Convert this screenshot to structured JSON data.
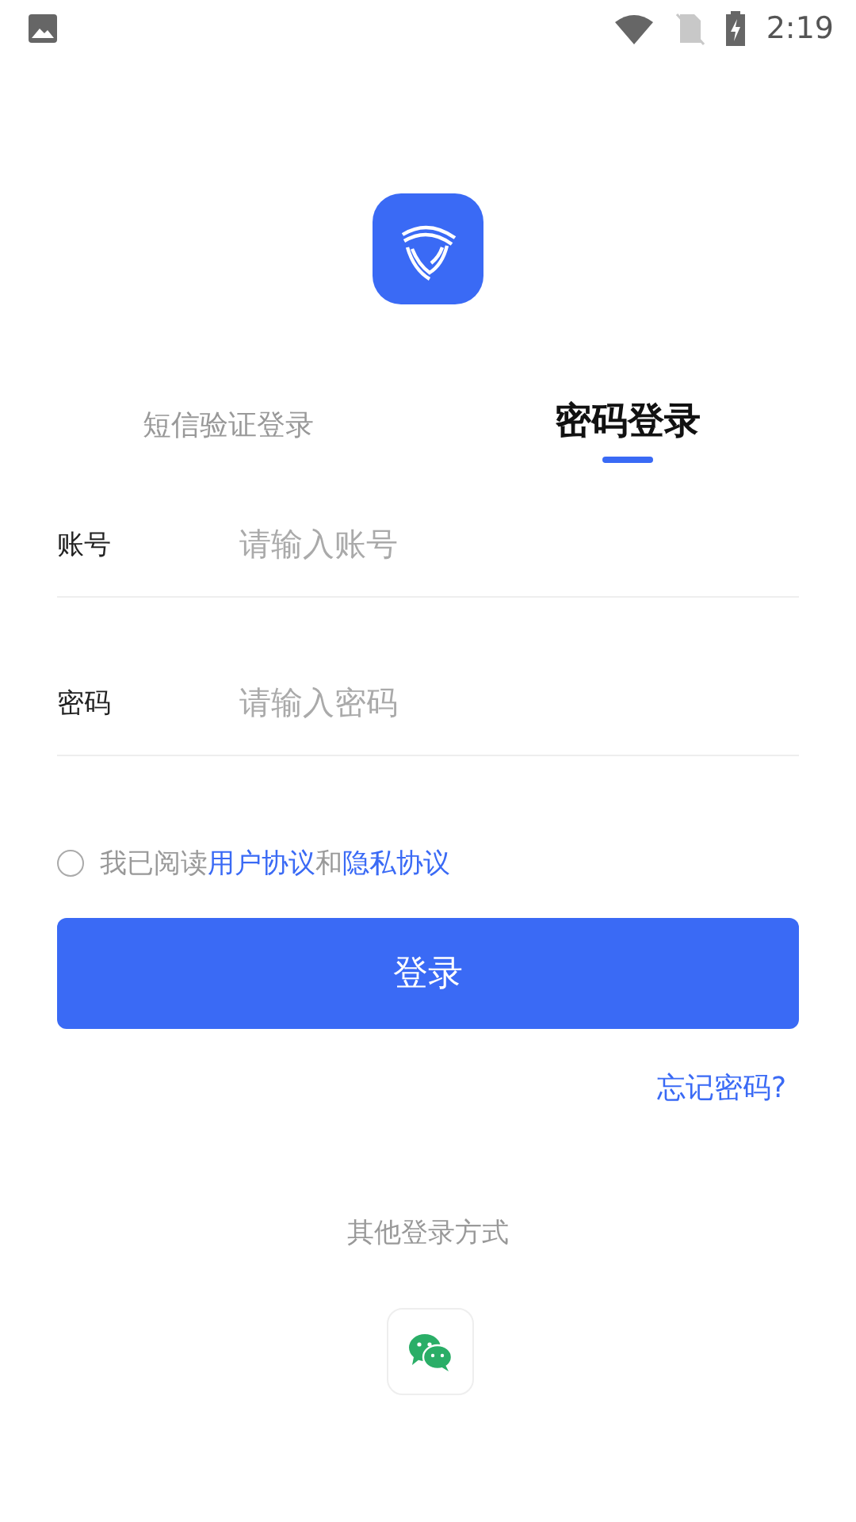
{
  "status_bar": {
    "time": "2:19"
  },
  "tabs": [
    {
      "label": "短信验证登录",
      "selected": false
    },
    {
      "label": "密码登录",
      "selected": true
    }
  ],
  "fields": [
    {
      "label": "账号",
      "placeholder": "请输入账号"
    },
    {
      "label": "密码",
      "placeholder": "请输入密码"
    }
  ],
  "agreement": {
    "checked": false,
    "parts": [
      {
        "kind": "text",
        "text": "我已阅读"
      },
      {
        "kind": "link",
        "text": "用户协议"
      },
      {
        "kind": "text",
        "text": "和"
      },
      {
        "kind": "link",
        "text": "隐私协议"
      }
    ]
  },
  "login_button": "登录",
  "forgot_password": "忘记密码?",
  "other_login": {
    "title": "其他登录方式"
  }
}
